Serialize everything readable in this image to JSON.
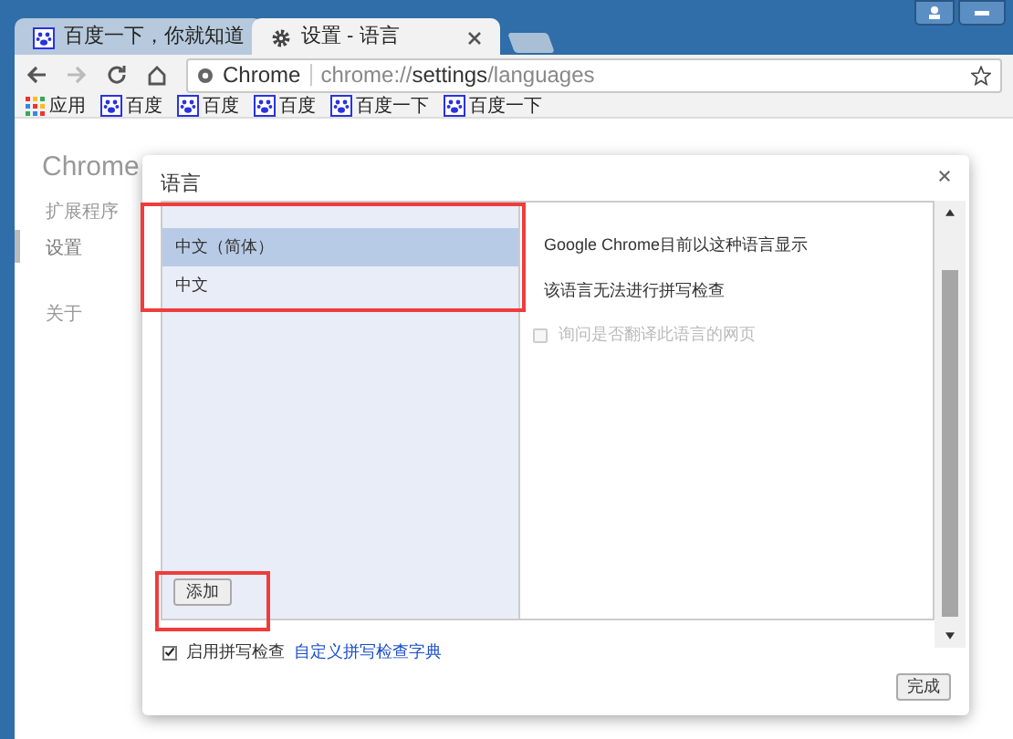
{
  "tabs": [
    {
      "title": "百度一下，你就知道",
      "selected": false
    },
    {
      "title": "设置 - 语言",
      "selected": true
    }
  ],
  "address_bar": {
    "site": "Chrome",
    "url_prefix": "chrome://",
    "url_bold": "settings",
    "url_suffix": "/languages"
  },
  "bookmarks": [
    {
      "label": "应用"
    },
    {
      "label": "百度"
    },
    {
      "label": "百度"
    },
    {
      "label": "百度"
    },
    {
      "label": "百度一下"
    },
    {
      "label": "百度一下"
    }
  ],
  "page": {
    "title": "Chrome",
    "sidebar": [
      {
        "label": "扩展程序",
        "selected": false
      },
      {
        "label": "设置",
        "selected": true
      },
      {
        "label": "关于",
        "selected": false
      }
    ]
  },
  "dialog": {
    "title": "语言",
    "languages": [
      {
        "label": "中文（简体）",
        "selected": true
      },
      {
        "label": "中文",
        "selected": false
      }
    ],
    "add_button": "添加",
    "details": [
      "Google Chrome目前以这种语言显示",
      "该语言无法进行拼写检查"
    ],
    "translate_option": {
      "label": "询问是否翻译此语言的网页",
      "checked": false,
      "disabled": true
    },
    "spellcheck": {
      "label": "启用拼写检查",
      "checked": true
    },
    "spellcheck_link": "自定义拼写检查字典",
    "done_button": "完成"
  }
}
